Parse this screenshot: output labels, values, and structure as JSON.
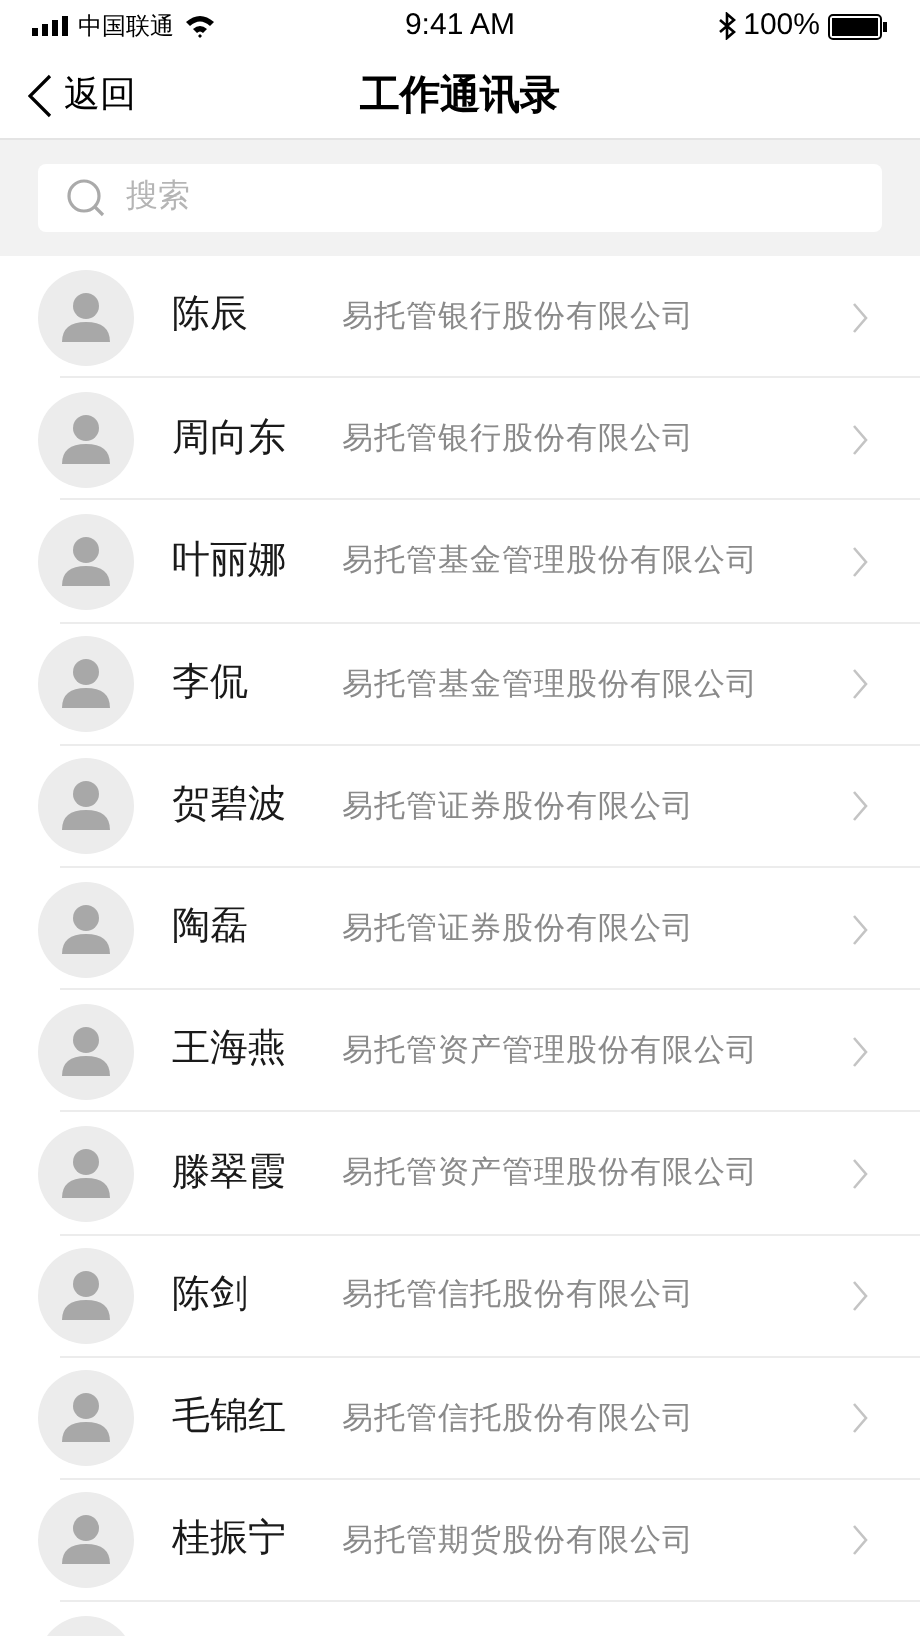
{
  "status_bar": {
    "carrier": "中国联通",
    "time": "9:41 AM",
    "battery": "100%"
  },
  "nav": {
    "back": "返回",
    "title": "工作通讯录"
  },
  "search": {
    "placeholder": "搜索"
  },
  "contacts": [
    {
      "name": "陈辰",
      "company": "易托管银行股份有限公司"
    },
    {
      "name": "周向东",
      "company": "易托管银行股份有限公司"
    },
    {
      "name": "叶丽娜",
      "company": "易托管基金管理股份有限公司"
    },
    {
      "name": "李侃",
      "company": "易托管基金管理股份有限公司"
    },
    {
      "name": "贺碧波",
      "company": "易托管证券股份有限公司"
    },
    {
      "name": "陶磊",
      "company": "易托管证券股份有限公司"
    },
    {
      "name": "王海燕",
      "company": "易托管资产管理股份有限公司"
    },
    {
      "name": "滕翠霞",
      "company": "易托管资产管理股份有限公司"
    },
    {
      "name": "陈剑",
      "company": "易托管信托股份有限公司"
    },
    {
      "name": "毛锦红",
      "company": "易托管信托股份有限公司"
    },
    {
      "name": "桂振宁",
      "company": "易托管期货股份有限公司"
    }
  ]
}
